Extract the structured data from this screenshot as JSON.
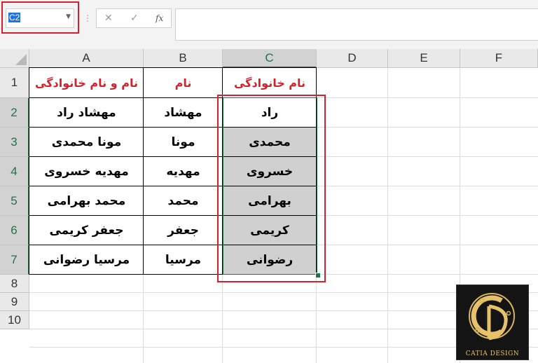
{
  "formula_bar": {
    "name_box": "C2",
    "separator": "⋮",
    "cancel_icon": "✕",
    "enter_icon": "✓",
    "function_icon": "fx",
    "formula": ""
  },
  "columns": [
    "A",
    "B",
    "C",
    "D",
    "E",
    "F"
  ],
  "rows": [
    "1",
    "2",
    "3",
    "4",
    "5",
    "6",
    "7",
    "8",
    "9",
    "10"
  ],
  "table": {
    "headers": [
      "نام و نام خانوادگی",
      "نام",
      "نام خانوادگی"
    ],
    "rows": [
      [
        "مهشاد راد",
        "مهشاد",
        "راد"
      ],
      [
        "مونا محمدی",
        "مونا",
        "محمدی"
      ],
      [
        "مهدیه خسروی",
        "مهدیه",
        "خسروی"
      ],
      [
        "محمد بهرامی",
        "محمد",
        "بهرامی"
      ],
      [
        "جعفر کریمی",
        "جعفر",
        "کریمی"
      ],
      [
        "مرسیا رضوانی",
        "مرسیا",
        "رضوانی"
      ]
    ]
  },
  "logo": {
    "caption": "CATIA DESIGN"
  },
  "colors": {
    "header_text": "#d3222b",
    "highlight_box": "#d3222b",
    "selection": "#217346",
    "flash_fill": "#d0d0d0"
  }
}
